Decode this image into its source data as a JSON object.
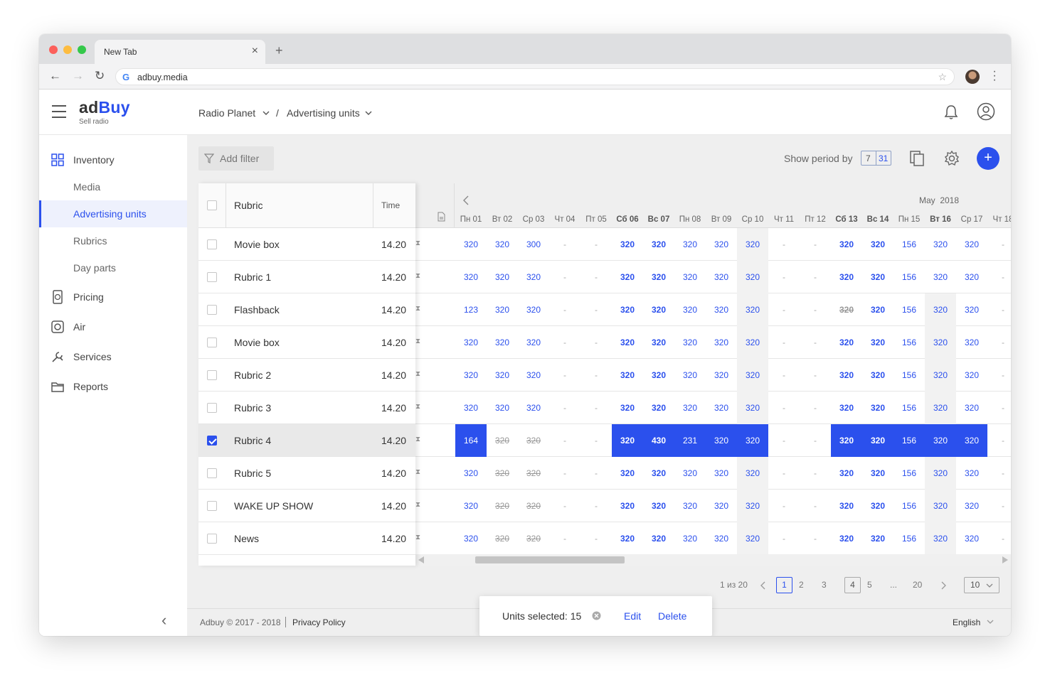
{
  "browser": {
    "tab_title": "New Tab",
    "url": "adbuy.media"
  },
  "header": {
    "logo_ad": "ad",
    "logo_buy": "Buy",
    "logo_sub": "Sell radio",
    "crumb_station": "Radio Planet",
    "crumb_sep": "/",
    "crumb_section": "Advertising units"
  },
  "sidebar": {
    "inventory": "Inventory",
    "media": "Media",
    "advertising_units": "Advertising units",
    "rubrics": "Rubrics",
    "day_parts": "Day parts",
    "pricing": "Pricing",
    "air": "Air",
    "services": "Services",
    "reports": "Reports"
  },
  "toolbar": {
    "add_filter": "Add filter",
    "show_period_by": "Show period by",
    "period_7": "7",
    "period_31": "31",
    "add": "+"
  },
  "table": {
    "col_rubric": "Rubric",
    "col_time": "Time",
    "month": "May  2018",
    "days": [
      "Пн 01",
      "Вт 02",
      "Ср 03",
      "Чт 04",
      "Пт 05",
      "Сб 06",
      "Вс 07",
      "Пн 08",
      "Вт 09",
      "Ср 10",
      "Чт 11",
      "Пт 12",
      "Сб 13",
      "Вс 14",
      "Пн 15",
      "Вт 16",
      "Ср 17",
      "Чт 18"
    ],
    "rows": [
      {
        "name": "Movie box",
        "time": "14.20",
        "selected": false,
        "cells": [
          "320",
          "320",
          "300",
          "-",
          "-",
          "320",
          "320",
          "320",
          "320",
          "320",
          "-",
          "-",
          "320",
          "320",
          "156",
          "320",
          "320",
          "-"
        ]
      },
      {
        "name": "Rubric 1",
        "time": "14.20",
        "selected": false,
        "cells": [
          "320",
          "320",
          "320",
          "-",
          "-",
          "320",
          "320",
          "320",
          "320",
          "320",
          "-",
          "-",
          "320",
          "320",
          "156",
          "320",
          "320",
          "-"
        ]
      },
      {
        "name": "Flashback",
        "time": "14.20",
        "selected": false,
        "cells": [
          "123",
          "320",
          "320",
          "-",
          "-",
          "320",
          "320",
          "320",
          "320",
          "320",
          "-",
          "-",
          "320",
          "320",
          "156",
          "320",
          "320",
          "-"
        ]
      },
      {
        "name": "Movie box",
        "time": "14.20",
        "selected": false,
        "cells": [
          "320",
          "320",
          "320",
          "-",
          "-",
          "320",
          "320",
          "320",
          "320",
          "320",
          "-",
          "-",
          "320",
          "320",
          "156",
          "320",
          "320",
          "-"
        ]
      },
      {
        "name": "Rubric 2",
        "time": "14.20",
        "selected": false,
        "cells": [
          "320",
          "320",
          "320",
          "-",
          "-",
          "320",
          "320",
          "320",
          "320",
          "320",
          "-",
          "-",
          "320",
          "320",
          "156",
          "320",
          "320",
          "-"
        ]
      },
      {
        "name": "Rubric 3",
        "time": "14.20",
        "selected": false,
        "cells": [
          "320",
          "320",
          "320",
          "-",
          "-",
          "320",
          "320",
          "320",
          "320",
          "320",
          "-",
          "-",
          "320",
          "320",
          "156",
          "320",
          "320",
          "-"
        ]
      },
      {
        "name": "Rubric 4",
        "time": "14.20",
        "selected": true,
        "cells": [
          "164",
          "320",
          "320",
          "-",
          "-",
          "320",
          "430",
          "231",
          "320",
          "320",
          "-",
          "-",
          "320",
          "320",
          "156",
          "320",
          "320",
          "-"
        ]
      },
      {
        "name": "Rubric 5",
        "time": "14.20",
        "selected": false,
        "cells": [
          "320",
          "320",
          "320",
          "-",
          "-",
          "320",
          "320",
          "320",
          "320",
          "320",
          "-",
          "-",
          "320",
          "320",
          "156",
          "320",
          "320",
          "-"
        ]
      },
      {
        "name": "WAKE UP SHOW",
        "time": "14.20",
        "selected": false,
        "cells": [
          "320",
          "320",
          "320",
          "-",
          "-",
          "320",
          "320",
          "320",
          "320",
          "320",
          "-",
          "-",
          "320",
          "320",
          "156",
          "320",
          "320",
          "-"
        ]
      },
      {
        "name": "News",
        "time": "14.20",
        "selected": false,
        "cells": [
          "320",
          "320",
          "320",
          "-",
          "-",
          "320",
          "320",
          "320",
          "320",
          "320",
          "-",
          "-",
          "320",
          "320",
          "156",
          "320",
          "320",
          "-"
        ]
      }
    ]
  },
  "pagination": {
    "info": "1 из 20",
    "pages": [
      "1",
      "2",
      "3",
      "4",
      "5",
      "...",
      "20"
    ],
    "current": "1",
    "per_page": "10"
  },
  "footer": {
    "copyright": "Adbuy © 2017 - 2018",
    "privacy": "Privacy Policy",
    "language": "English"
  },
  "toast": {
    "text": "Units selected: 15",
    "edit": "Edit",
    "delete": "Delete"
  },
  "colors": {
    "accent": "#2b50ed"
  }
}
